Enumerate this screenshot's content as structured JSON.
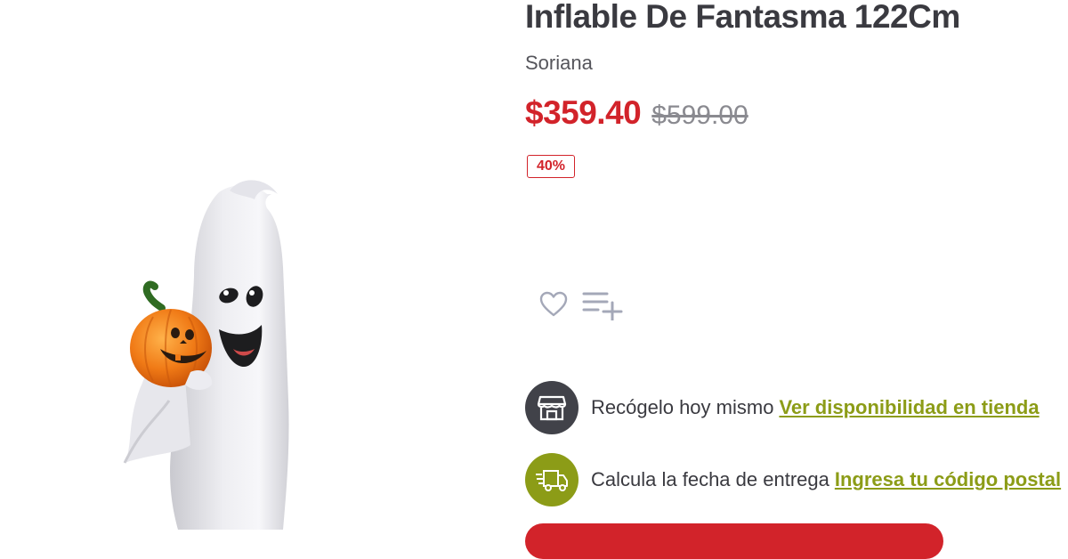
{
  "product": {
    "title": "Inflable De Fantasma 122Cm",
    "brand": "Soriana",
    "price_current": "$359.40",
    "price_original": "$599.00",
    "discount": "40%"
  },
  "pickup": {
    "text": "Recógelo hoy mismo",
    "link": "Ver disponibilidad en tienda"
  },
  "delivery": {
    "text": "Calcula la fecha de entrega",
    "link": "Ingresa tu código postal"
  },
  "colors": {
    "price_red": "#d2232a",
    "accent_olive": "#8c9c17",
    "text_dark": "#3a3a40",
    "icon_circle_dark": "#414249"
  },
  "icons": [
    "heart-icon",
    "add-to-list-icon",
    "store-icon",
    "delivery-truck-icon"
  ]
}
